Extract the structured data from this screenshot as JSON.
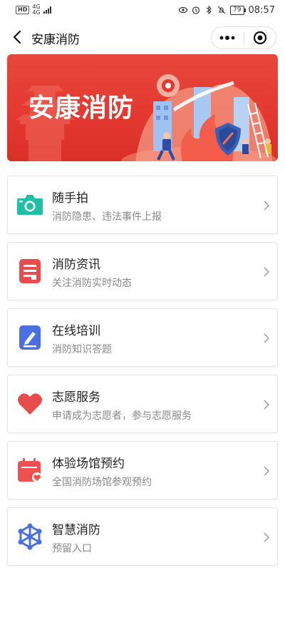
{
  "status_bar": {
    "hd": "HD",
    "net_top": "4G",
    "net_bottom": "4G",
    "battery": "79",
    "time": "08:57"
  },
  "nav": {
    "title": "安康消防",
    "back_icon": "chevron-left-icon",
    "more_icon": "more-dots-icon",
    "close_icon": "target-close-icon"
  },
  "banner": {
    "title": "安康消防"
  },
  "colors": {
    "banner_red": "#e3382f",
    "camera_teal": "#1fbfa6",
    "news_red": "#e84b4b",
    "training_blue": "#4a6fe0",
    "heart_red": "#e84b4b",
    "calendar_red": "#ef5050",
    "smart_blue": "#4a6fe0"
  },
  "menu": [
    {
      "title": "随手拍",
      "desc": "消防隐患、违法事件上报",
      "icon": "camera-icon"
    },
    {
      "title": "消防资讯",
      "desc": "关注消防实时动态",
      "icon": "news-document-icon"
    },
    {
      "title": "在线培训",
      "desc": "消防知识答题",
      "icon": "pen-edit-icon"
    },
    {
      "title": "志愿服务",
      "desc": "申请成为志愿者，参与志愿服务",
      "icon": "heart-icon"
    },
    {
      "title": "体验场馆预约",
      "desc": "全国消防场馆参观预约",
      "icon": "calendar-heart-icon"
    },
    {
      "title": "智慧消防",
      "desc": "预留入口",
      "icon": "network-hexagon-icon"
    }
  ]
}
